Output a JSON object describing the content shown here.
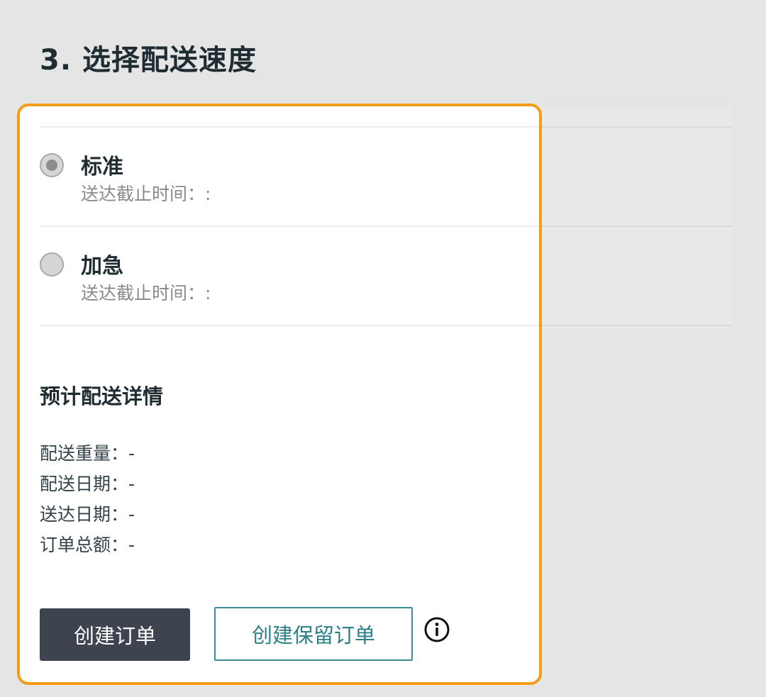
{
  "section": {
    "title": "3. 选择配送速度"
  },
  "shipping_speed": {
    "options": [
      {
        "label": "标准",
        "deadline": "送达截止时间：:",
        "selected": true
      },
      {
        "label": "加急",
        "deadline": "送达截止时间：:",
        "selected": false
      }
    ]
  },
  "delivery_details": {
    "title": "预计配送详情",
    "rows": [
      "配送重量：-",
      "配送日期：-",
      "送达日期：-",
      "订单总额：-"
    ]
  },
  "actions": {
    "create_order": "创建订单",
    "create_hold_order": "创建保留订单"
  },
  "icons": {
    "info": "info-icon"
  },
  "colors": {
    "highlight": "#f59c1a",
    "primary_button": "#3d4450",
    "outline_button": "#3a8f96",
    "background": "#e5e5e5"
  }
}
